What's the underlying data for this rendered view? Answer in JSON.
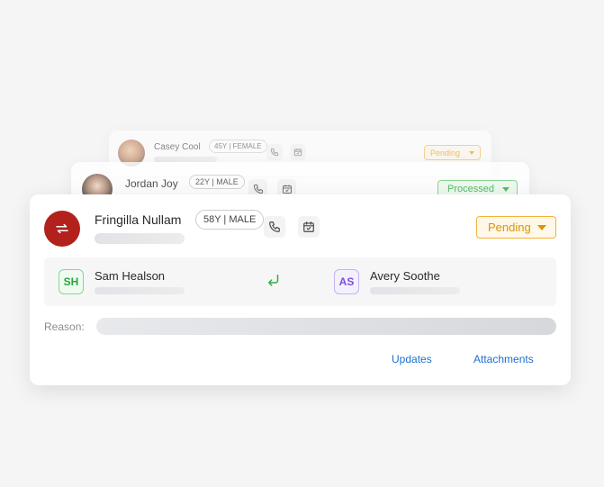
{
  "colors": {
    "main_avatar_bg": "#b3211c",
    "pending": "#d99400",
    "processed": "#2fae45",
    "link": "#1d6fd1"
  },
  "back_card_1": {
    "name": "Casey Cool",
    "badge": "45Y | FEMALE",
    "status": "Pending",
    "icons": [
      "phone-icon",
      "calendar-check-icon"
    ]
  },
  "back_card_2": {
    "name": "Jordan Joy",
    "badge": "22Y | MALE",
    "status": "Processed",
    "icons": [
      "phone-icon",
      "calendar-check-icon"
    ]
  },
  "main_card": {
    "name": "Fringilla Nullam",
    "badge": "58Y | MALE",
    "status": "Pending",
    "icons": [
      "transfer-arrows-icon",
      "phone-icon",
      "calendar-check-icon",
      "return-arrow-icon"
    ],
    "from": {
      "initials": "SH",
      "name": "Sam Healson"
    },
    "to": {
      "initials": "AS",
      "name": "Avery Soothe"
    },
    "reason_label": "Reason:",
    "links": {
      "updates": "Updates",
      "attachments": "Attachments"
    }
  }
}
